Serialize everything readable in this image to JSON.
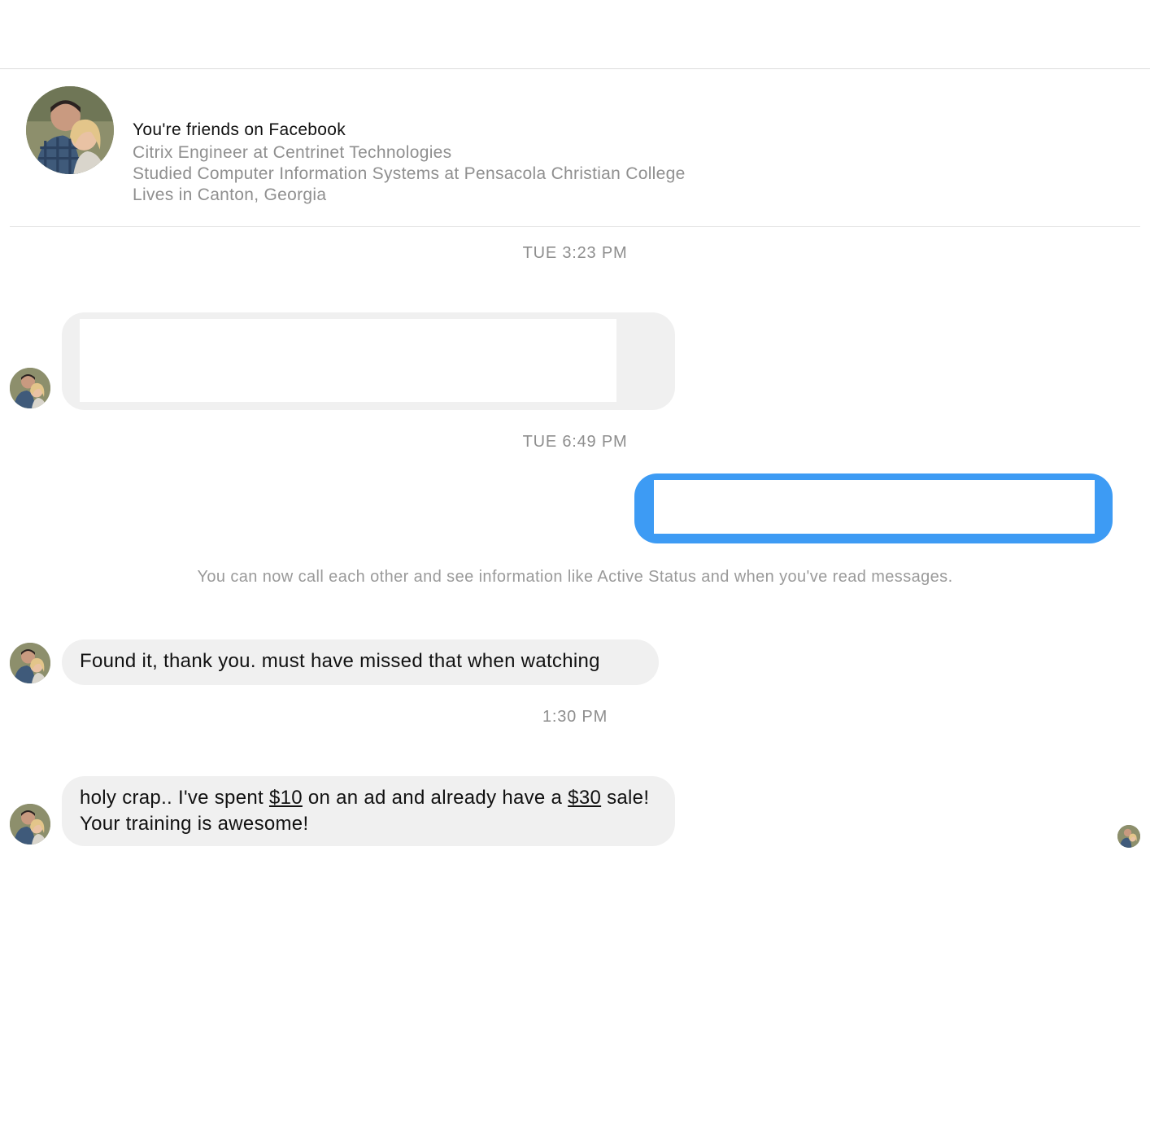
{
  "profile": {
    "title": "You're friends on Facebook",
    "lines": [
      "Citrix Engineer at Centrinet Technologies",
      "Studied Computer Information Systems at Pensacola Christian College",
      "Lives in Canton, Georgia"
    ]
  },
  "conversation": {
    "timestamps": [
      "TUE 3:23 PM",
      "TUE 6:49 PM",
      "1:30 PM"
    ],
    "system_note": "You can now call each other and see information like Active Status and when you've read messages.",
    "messages": [
      {
        "sender": "contact",
        "text": "",
        "redacted": true
      },
      {
        "sender": "me",
        "text": "",
        "redacted": true
      },
      {
        "sender": "contact",
        "text": "Found it, thank you. must have missed that when watching"
      },
      {
        "sender": "contact",
        "parts": [
          "holy crap.. I've spent ",
          "$10",
          " on an ad and already have a ",
          "$30",
          " sale! Your training is awesome!"
        ]
      }
    ]
  },
  "colors": {
    "outgoing_bubble": "#3d9bf4",
    "incoming_bubble": "#f0f0f0",
    "meta_text": "#8e8e8e"
  },
  "icons": [
    "contact-avatar",
    "seen-receipt-avatar"
  ]
}
